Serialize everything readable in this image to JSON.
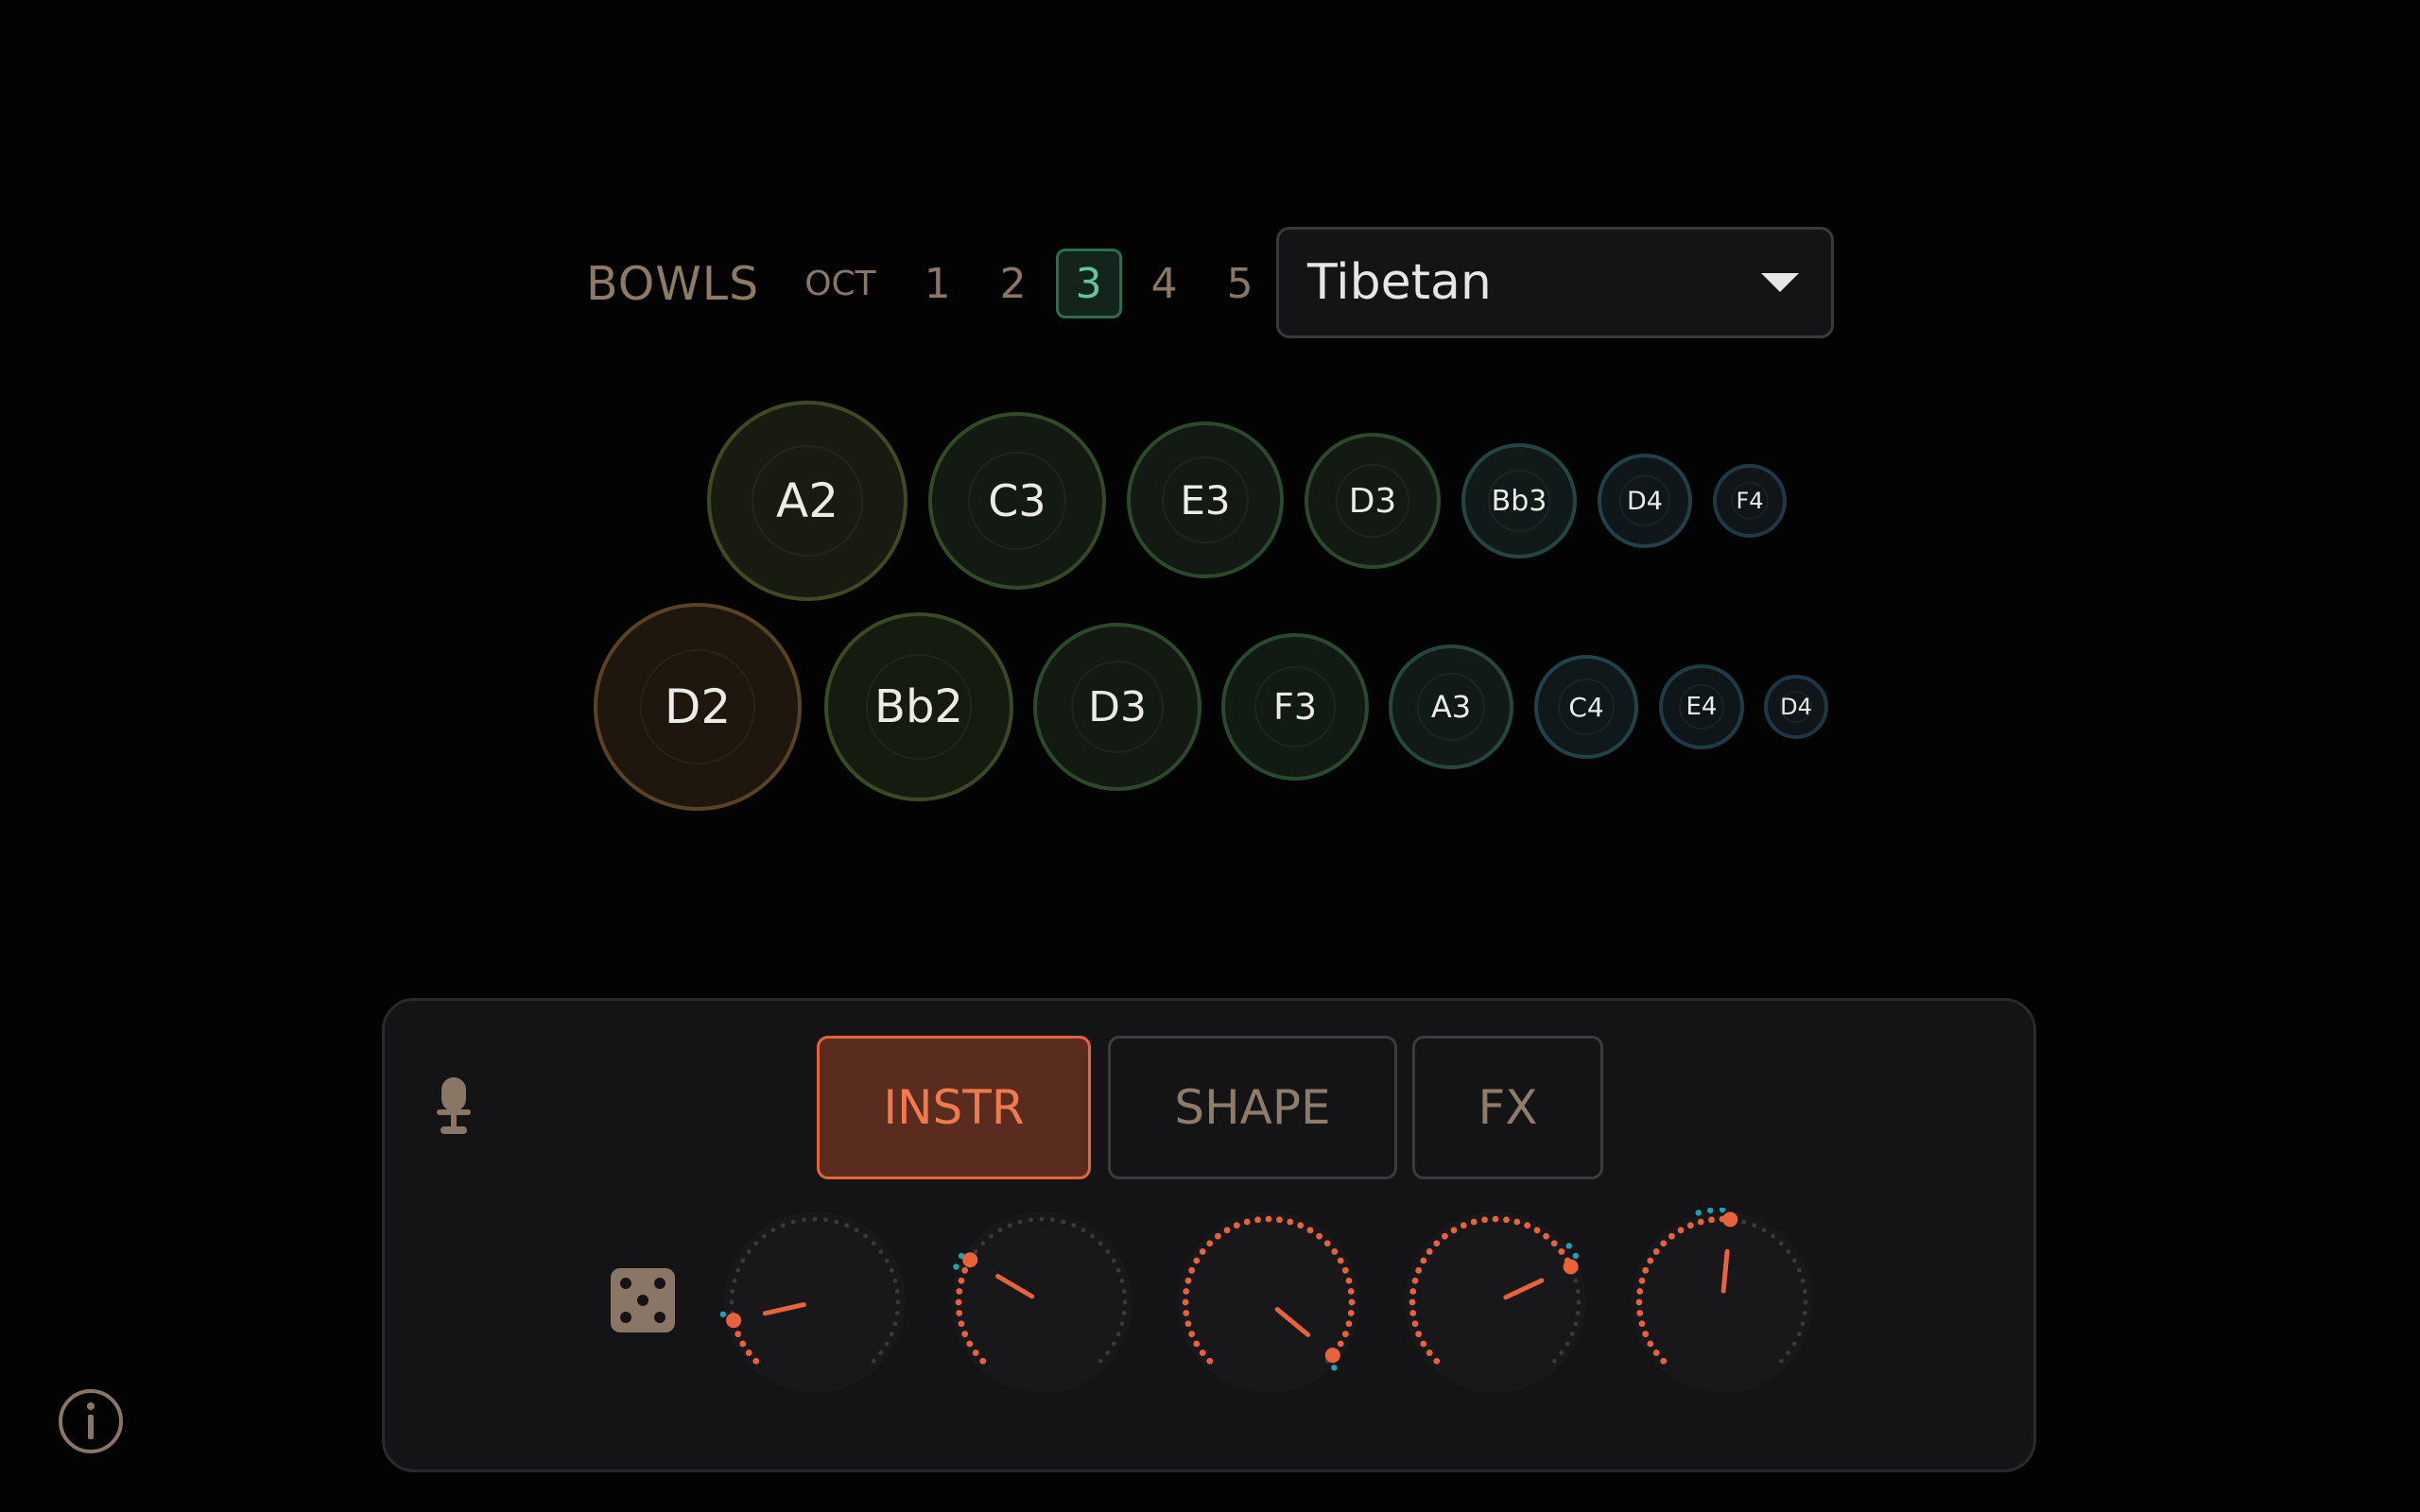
{
  "header": {
    "bowls_label": "BOWLS",
    "oct_label": "OCT",
    "octaves": [
      "1",
      "2",
      "3",
      "4",
      "5"
    ],
    "active_octave": "3"
  },
  "scale_select": {
    "value": "Tibetan"
  },
  "bowls_row1": [
    "A2",
    "C3",
    "E3",
    "D3",
    "Bb3",
    "D4",
    "F4"
  ],
  "bowls_row2": [
    "D2",
    "Bb2",
    "D3",
    "F3",
    "A3",
    "C4",
    "E4",
    "D4"
  ],
  "tabs": {
    "instr": "INSTR",
    "shape": "SHAPE",
    "fx": "FX",
    "active": "INSTR"
  },
  "knobs": [
    {
      "value": 0.12,
      "mod": 0.03
    },
    {
      "value": 0.28,
      "mod": -0.04
    },
    {
      "value": 0.98,
      "mod": 0.06
    },
    {
      "value": 0.74,
      "mod": -0.07
    },
    {
      "value": 0.52,
      "mod": -0.1
    }
  ],
  "colors": {
    "accent": "#e8623a",
    "mod": "#1ba3b3",
    "active_octave": "#63c79a",
    "label": "#8f7a66"
  },
  "icons": {
    "mic": "microphone-icon",
    "dice": "dice-icon",
    "info": "info-icon",
    "caret": "chevron-down-icon"
  }
}
